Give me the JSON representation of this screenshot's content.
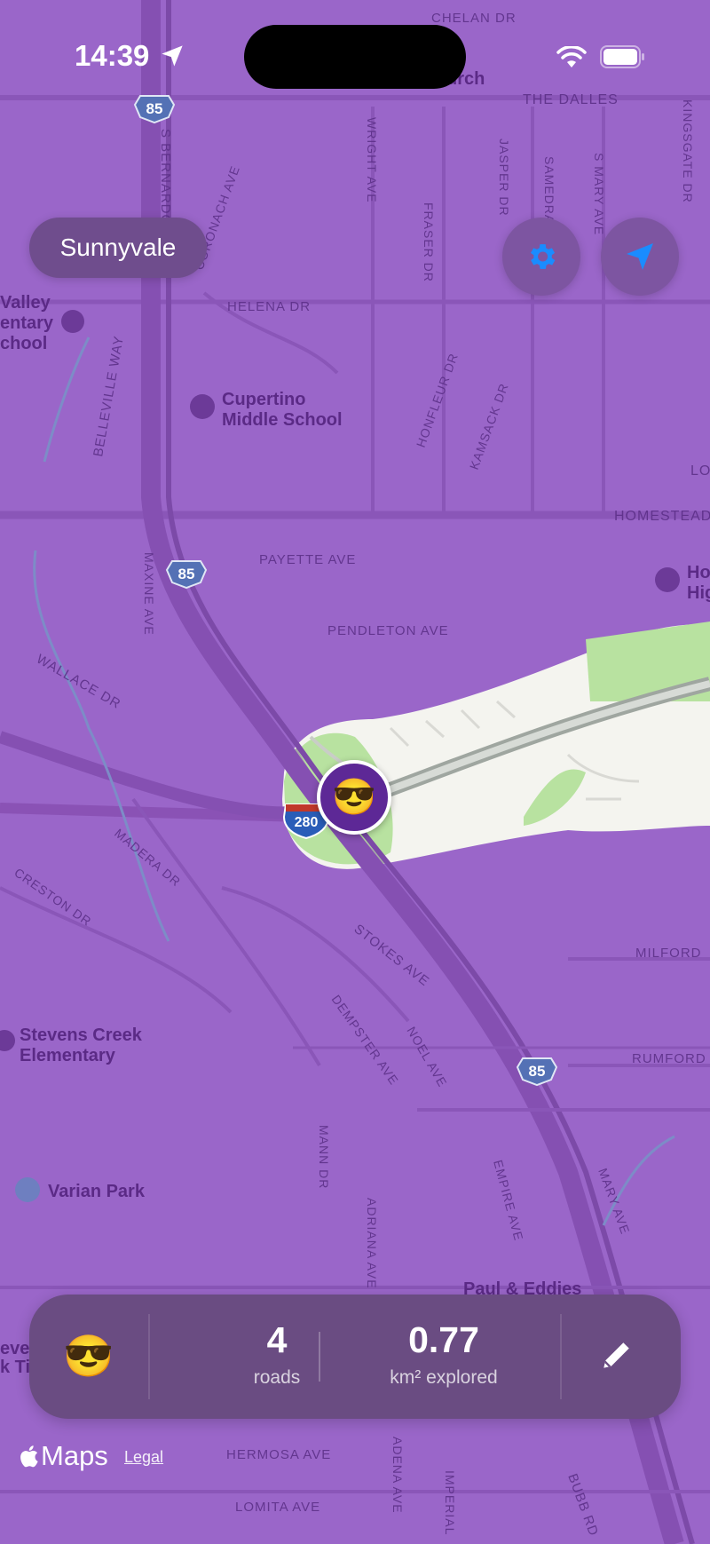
{
  "status_bar": {
    "time": "14:39"
  },
  "header": {
    "city": "Sunnyvale"
  },
  "controls": {
    "settings": "gear-icon",
    "locate": "location-arrow-icon"
  },
  "player": {
    "avatar": "😎"
  },
  "stats_panel": {
    "avatar": "😎",
    "roads_value": "4",
    "roads_label": "roads",
    "area_value": "0.77",
    "area_label": "km² explored",
    "edit": "pencil-icon"
  },
  "footer": {
    "maps": "Maps",
    "legal": "Legal"
  },
  "map": {
    "fog_color": "#9a66c9",
    "explored_color": "#f3f3ef",
    "park_color": "#b9e3a2",
    "streets": {
      "chelan": "CHELAN DR",
      "dalles": "THE DALLES",
      "bernardo": "S BERNARDO",
      "coronach": "CORONACH AVE",
      "wright": "WRIGHT AVE",
      "fraser": "FRASER DR",
      "jasper": "JASPER DR",
      "samedra": "SAMEDRA",
      "mary_n": "S MARY AVE",
      "kingsgate": "KINGSGATE DR",
      "helena": "HELENA DR",
      "belleville": "BELLEVILLE WAY",
      "honfleur": "HONFLEUR DR",
      "kamsack": "KAMSACK DR",
      "homestead": "HOMESTEAD",
      "payette": "PAYETTE AVE",
      "maxine": "MAXINE AVE",
      "pendleton": "PENDLETON AVE",
      "wallace": "WALLACE DR",
      "madera": "MADERA DR",
      "creston": "CRESTON DR",
      "stokes": "STOKES AVE",
      "dempster": "DEMPSTER AVE",
      "noel": "NOEL AVE",
      "milford": "MILFORD",
      "rumford": "RUMFORD",
      "mann": "MANN DR",
      "adriana": "ADRIANA AVE",
      "empire": "EMPIRE AVE",
      "mary_s": "MARY AVE",
      "hermosa": "HERMOSA AVE",
      "lomita": "LOMITA AVE",
      "imperial": "IMPERIAL",
      "bubb": "BUBB RD",
      "adena": "ADENA AVE"
    },
    "pois": {
      "church": "urch",
      "valley": "Valley",
      "elementary": "entary",
      "school": "chool",
      "cupertino": "Cupertino",
      "middle_school": "Middle School",
      "high_ho": "Ho",
      "high_hi": "Hig",
      "stevens": "Stevens Creek",
      "stevens2": "Elementary",
      "varian": "Varian Park",
      "paul": "Paul & Eddies",
      "left_eve": "eve",
      "left_k": "k Ti",
      "lo": "LO"
    },
    "shields": {
      "hwy85": "85",
      "i280": "280"
    }
  }
}
